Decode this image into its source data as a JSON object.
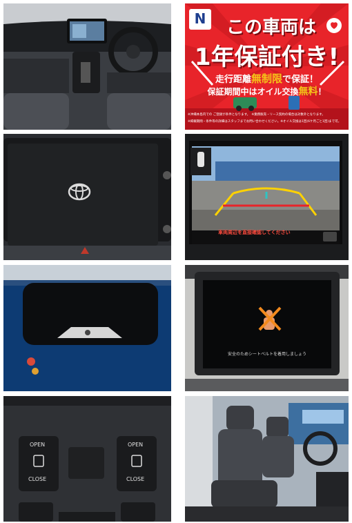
{
  "promo": {
    "logo_letter": "N",
    "line1": "この車両は",
    "line2": "1年保証付き!",
    "line3_prefix": "走行距離",
    "line3_emph": "無制限",
    "line3_suffix": "で保証！",
    "line4_prefix": "保証期間中はオイル交換",
    "line4_emph": "無料",
    "line4_suffix": "！",
    "footnote1": "※沖縄本島内での ご登録が条件となります。　※業務販売・リース契約の場合は対象外となります。",
    "footnote2": "※掲載期間・条件等の詳細はスタッフまでお問い合わせください。※オイル交換は1回(6ケ月ごと1回)まで可。",
    "colors": {
      "red": "#e8242a",
      "dark_red": "#b3121b",
      "gold": "#f5c518"
    }
  },
  "camera": {
    "warning_text": "車両周辺を直接確認してください"
  },
  "ceiling_monitor": {
    "message": "安全のためシートベルトを着用しましょう"
  },
  "door_switches": {
    "left_open": "OPEN",
    "left_close": "CLOSE",
    "right_open": "OPEN",
    "right_close": "CLOSE"
  }
}
